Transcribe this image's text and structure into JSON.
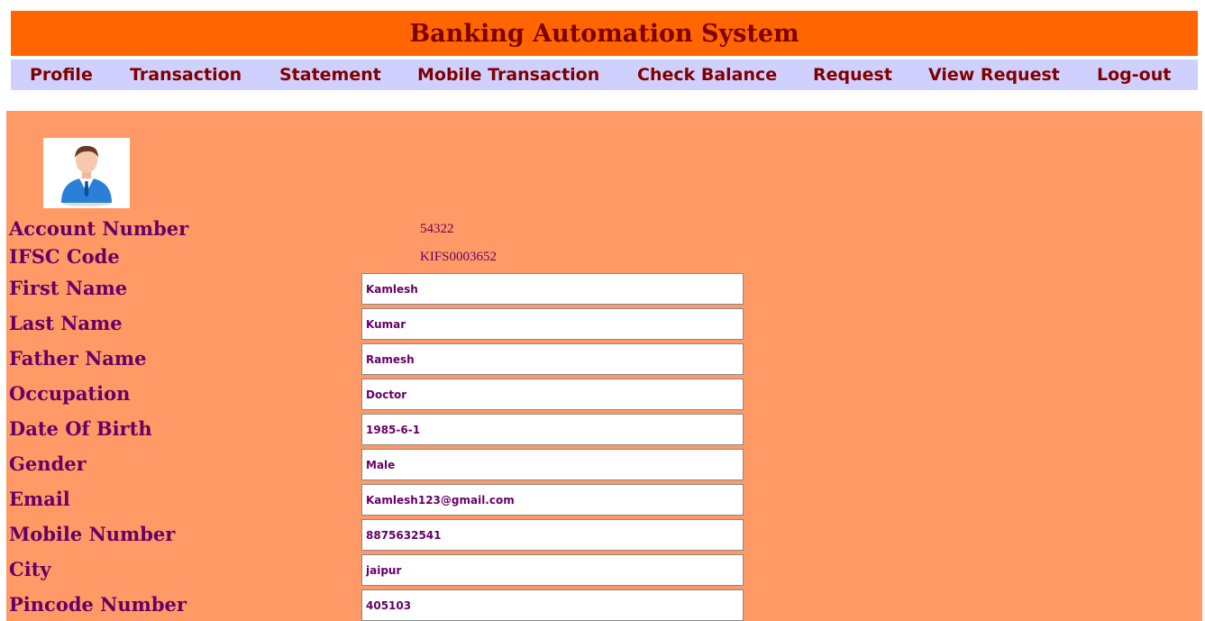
{
  "header": {
    "title": "Banking Automation System"
  },
  "nav": {
    "items": [
      {
        "label": "Profile"
      },
      {
        "label": "Transaction"
      },
      {
        "label": "Statement"
      },
      {
        "label": "Mobile Transaction"
      },
      {
        "label": "Check Balance"
      },
      {
        "label": "Request"
      },
      {
        "label": "View Request"
      },
      {
        "label": "Log-out"
      }
    ]
  },
  "profile": {
    "avatar_icon": "user-avatar-icon",
    "account_number": {
      "label": "Account Number",
      "value": "54322"
    },
    "ifsc_code": {
      "label": "IFSC Code",
      "value": "KIFS0003652"
    },
    "fields": [
      {
        "label": "First Name",
        "value": "Kamlesh"
      },
      {
        "label": "Last Name",
        "value": "Kumar"
      },
      {
        "label": "Father Name",
        "value": "Ramesh"
      },
      {
        "label": "Occupation",
        "value": "Doctor"
      },
      {
        "label": "Date Of Birth",
        "value": "1985-6-1"
      },
      {
        "label": "Gender",
        "value": "Male"
      },
      {
        "label": "Email",
        "value": "Kamlesh123@gmail.com"
      },
      {
        "label": "Mobile Number",
        "value": "8875632541"
      },
      {
        "label": "City",
        "value": "jaipur"
      },
      {
        "label": "Pincode Number",
        "value": "405103"
      }
    ]
  },
  "colors": {
    "header_bg": "#ff6600",
    "nav_bg": "#d0d0ff",
    "nav_text": "#800000",
    "content_bg": "#ff9966",
    "label_text": "#660066"
  }
}
